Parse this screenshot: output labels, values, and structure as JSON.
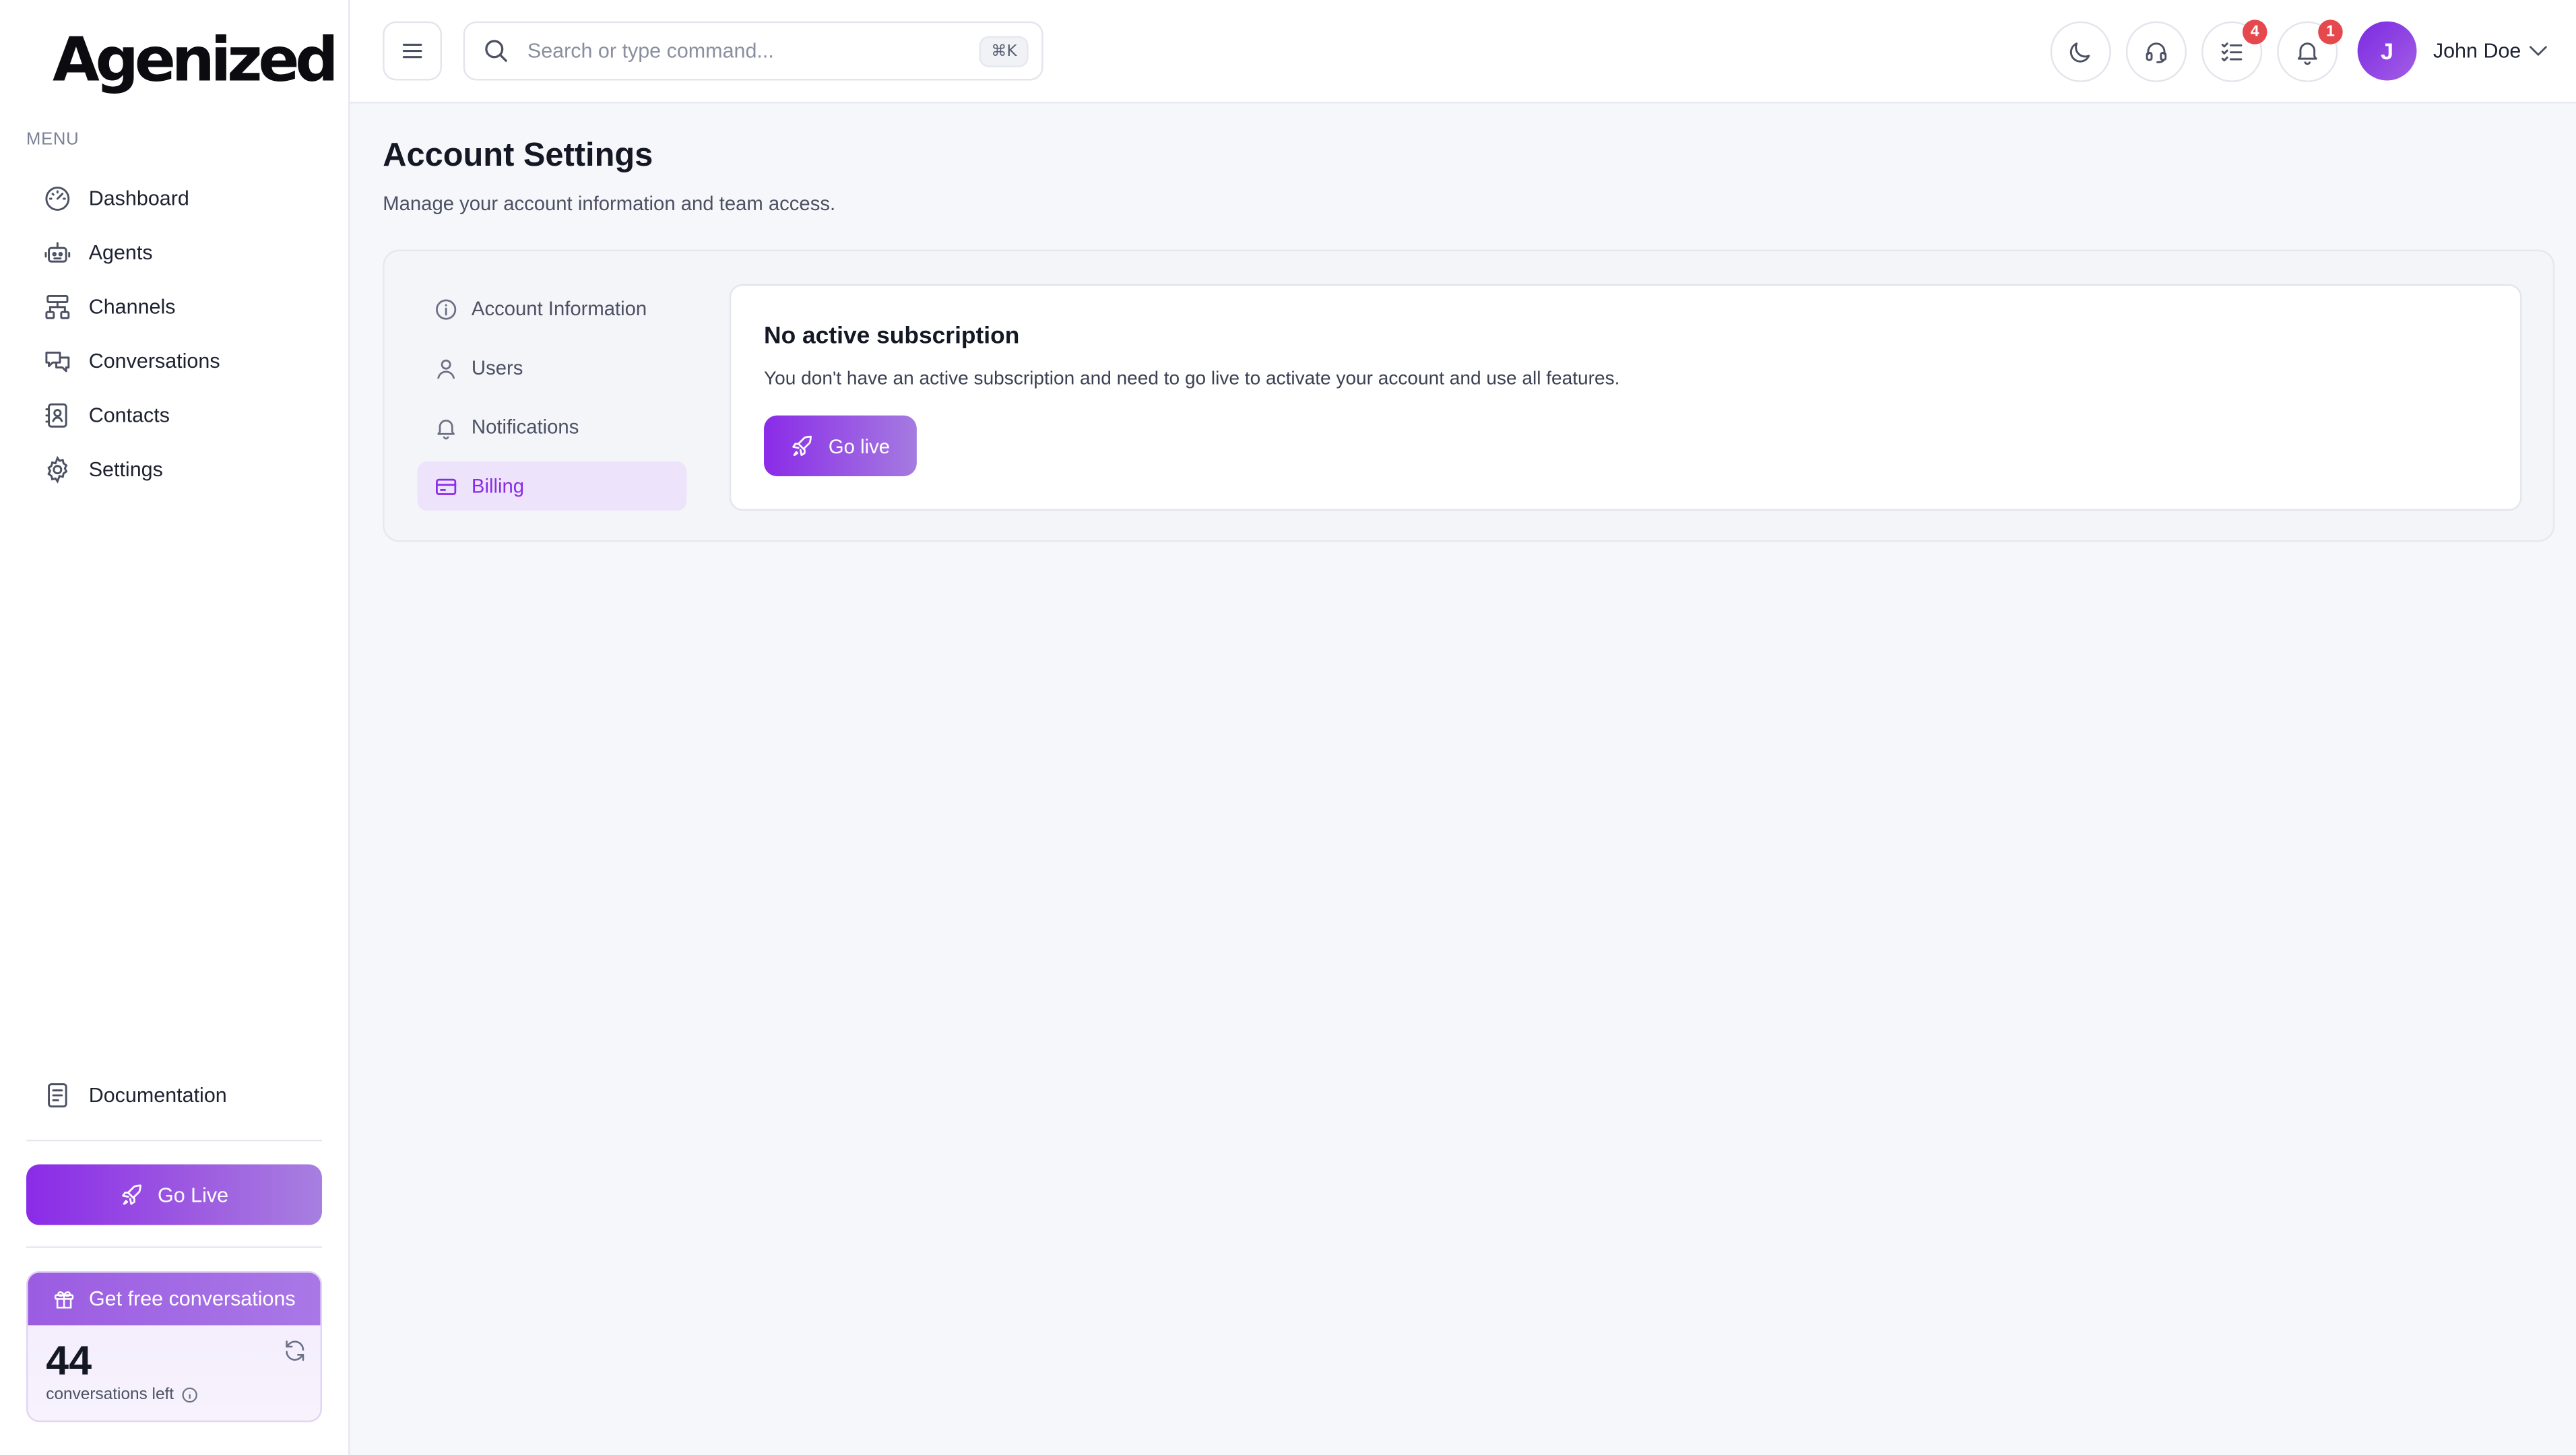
{
  "brand": {
    "logo_text": "Agenized"
  },
  "sidebar": {
    "menu_label": "MENU",
    "items": [
      {
        "label": "Dashboard",
        "icon": "dashboard-gauge-icon"
      },
      {
        "label": "Agents",
        "icon": "robot-icon"
      },
      {
        "label": "Channels",
        "icon": "channels-hierarchy-icon"
      },
      {
        "label": "Conversations",
        "icon": "chat-bubbles-icon"
      },
      {
        "label": "Contacts",
        "icon": "contact-book-icon"
      },
      {
        "label": "Settings",
        "icon": "gear-icon"
      }
    ],
    "documentation_label": "Documentation",
    "go_live_label": "Go Live",
    "promo": {
      "header_label": "Get free conversations",
      "count": "44",
      "subtitle": "conversations left"
    }
  },
  "topbar": {
    "search_placeholder": "Search or type command...",
    "shortcut": "⌘K",
    "tasks_badge": "4",
    "notifications_badge": "1",
    "user": {
      "initial": "J",
      "name": "John Doe"
    }
  },
  "main": {
    "title": "Account Settings",
    "subtitle": "Manage your account information and team access.",
    "tabs": [
      {
        "label": "Account Information",
        "icon": "info-circle-icon"
      },
      {
        "label": "Users",
        "icon": "user-icon"
      },
      {
        "label": "Notifications",
        "icon": "bell-icon"
      },
      {
        "label": "Billing",
        "icon": "credit-card-icon",
        "active": true
      }
    ],
    "card": {
      "title": "No active subscription",
      "text": "You don't have an active subscription and need to go live to activate your account and use all features.",
      "button_label": "Go live"
    }
  },
  "colors": {
    "accent": "#8a2be8",
    "badge": "#e5484d",
    "background": "#f6f7fb"
  }
}
